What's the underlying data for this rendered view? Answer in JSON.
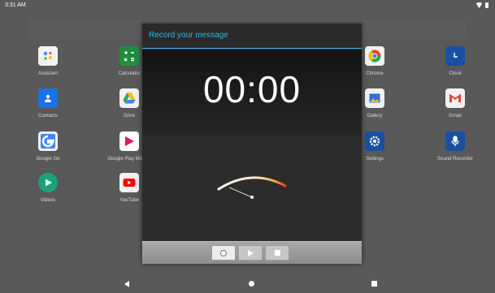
{
  "status_bar": {
    "time": "3:31 AM"
  },
  "apps": [
    {
      "label": "Assistant",
      "icon": "assistant-icon",
      "color": "#f1f1f1"
    },
    {
      "label": "Calculator",
      "icon": "calculator-icon",
      "color": "#1e8e3e"
    },
    {
      "label": "Chrome",
      "icon": "chrome-icon",
      "color": "#f1f1f1"
    },
    {
      "label": "Clock",
      "icon": "clock-icon",
      "color": "#1a4fa3"
    },
    {
      "label": "Contacts",
      "icon": "contacts-icon",
      "color": "#1a73e8"
    },
    {
      "label": "Drive",
      "icon": "drive-icon",
      "color": "#f1f1f1"
    },
    {
      "label": "Gallery",
      "icon": "gallery-icon",
      "color": "#f1f1f1"
    },
    {
      "label": "Gmail",
      "icon": "gmail-icon",
      "color": "#f1f1f1"
    },
    {
      "label": "Google Go",
      "icon": "google-go-icon",
      "color": "#f1f1f1"
    },
    {
      "label": "Google Play Movies",
      "icon": "play-movies-icon",
      "color": "#ffffff"
    },
    {
      "label": "Settings",
      "icon": "settings-icon",
      "color": "#1a4fa3"
    },
    {
      "label": "Sound Recorder",
      "icon": "microphone-icon",
      "color": "#1a4fa3"
    },
    {
      "label": "Videos",
      "icon": "videos-icon",
      "color": "#1aa37a"
    },
    {
      "label": "YouTube",
      "icon": "youtube-icon",
      "color": "#f1f1f1"
    }
  ],
  "dialog": {
    "title": "Record your message",
    "timer": "00:00",
    "accent": "#33b5e5",
    "controls": [
      {
        "name": "record",
        "icon": "record-icon",
        "selected": true
      },
      {
        "name": "play",
        "icon": "play-icon"
      },
      {
        "name": "stop",
        "icon": "stop-icon"
      }
    ]
  },
  "navigation": {
    "back": "back-icon",
    "home": "home-icon",
    "recents": "recents-icon"
  }
}
